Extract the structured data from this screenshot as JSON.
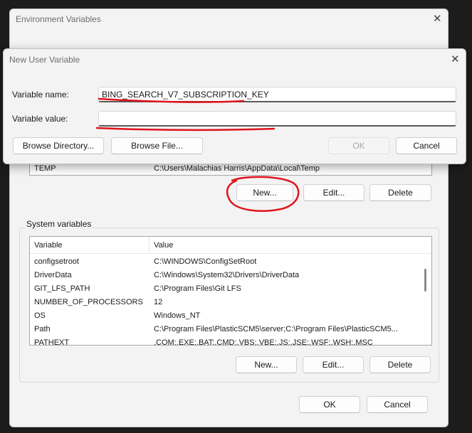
{
  "env_dialog": {
    "title": "Environment Variables",
    "user_section": {
      "visible_row": {
        "variable": "TEMP",
        "value": "C:\\Users\\Malachias Harris\\AppData\\Local\\Temp"
      },
      "new_label": "New...",
      "edit_label": "Edit...",
      "delete_label": "Delete"
    },
    "system_section": {
      "title": "System variables",
      "columns": [
        "Variable",
        "Value"
      ],
      "rows": [
        {
          "variable": "configsetroot",
          "value": "C:\\WINDOWS\\ConfigSetRoot"
        },
        {
          "variable": "DriverData",
          "value": "C:\\Windows\\System32\\Drivers\\DriverData"
        },
        {
          "variable": "GIT_LFS_PATH",
          "value": "C:\\Program Files\\Git LFS"
        },
        {
          "variable": "NUMBER_OF_PROCESSORS",
          "value": "12"
        },
        {
          "variable": "OS",
          "value": "Windows_NT"
        },
        {
          "variable": "Path",
          "value": "C:\\Program Files\\PlasticSCM5\\server;C:\\Program Files\\PlasticSCM5..."
        },
        {
          "variable": "PATHEXT",
          "value": ".COM;.EXE;.BAT;.CMD;.VBS;.VBE;.JS;.JSE;.WSF;.WSH;.MSC"
        }
      ],
      "new_label": "New...",
      "edit_label": "Edit...",
      "delete_label": "Delete"
    },
    "ok_label": "OK",
    "cancel_label": "Cancel"
  },
  "new_var_dialog": {
    "title": "New User Variable",
    "name_label": "Variable name:",
    "name_value": "BING_SEARCH_V7_SUBSCRIPTION_KEY",
    "value_label": "Variable value:",
    "value_value": "",
    "browse_directory_label": "Browse Directory...",
    "browse_file_label": "Browse File...",
    "ok_label": "OK",
    "cancel_label": "Cancel"
  },
  "annotation_color": "#e0131b"
}
